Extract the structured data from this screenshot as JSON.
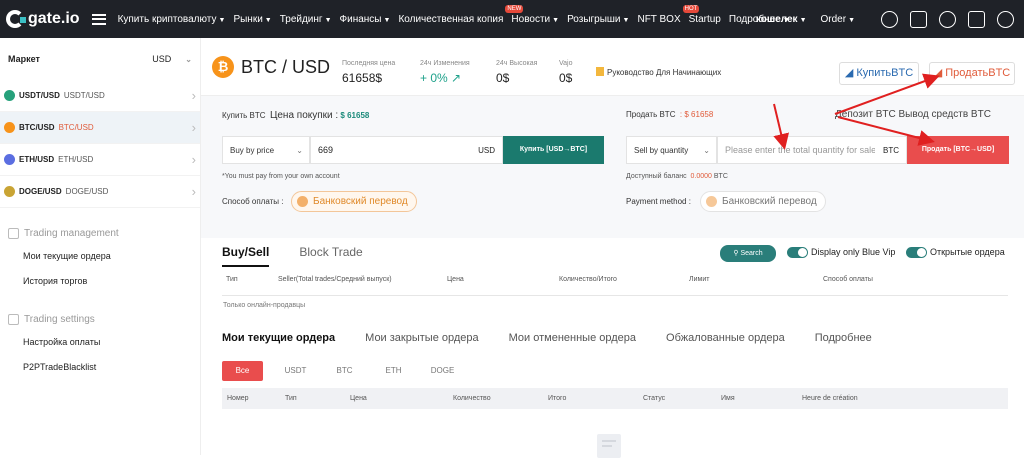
{
  "nav": {
    "logo": "gate.io",
    "links": [
      {
        "label": "Купить криптовалюту",
        "caret": "▼",
        "badge": ""
      },
      {
        "label": "Рынки",
        "caret": "▼",
        "badge": ""
      },
      {
        "label": "Трейдинг",
        "caret": "▼",
        "badge": ""
      },
      {
        "label": "Финансы",
        "caret": "▼",
        "badge": ""
      },
      {
        "label": "Количественная копия",
        "caret": "",
        "badge": ""
      },
      {
        "label": "Новости",
        "caret": "▼",
        "badge": "NEW"
      },
      {
        "label": "Розыгрыши",
        "caret": "▼",
        "badge": ""
      },
      {
        "label": "NFT BOX",
        "caret": "",
        "badge": ""
      },
      {
        "label": "Startup",
        "caret": "",
        "badge": "HOT"
      },
      {
        "label": "Подробнее",
        "caret": "▼",
        "badge": ""
      }
    ],
    "wallet": "кошелек",
    "order": "Order"
  },
  "sidebar": {
    "market_label": "Маркет",
    "currency": "USD",
    "markets": [
      {
        "pair": "USDT/USD",
        "pair2": "USDT/USD",
        "color": "#26a17b"
      },
      {
        "pair": "BTC/USD",
        "pair2": "BTC/USD",
        "color": "#f7931a"
      },
      {
        "pair": "ETH/USD",
        "pair2": "ETH/USD",
        "color": "#5b6ee1"
      },
      {
        "pair": "DOGE/USD",
        "pair2": "DOGE/USD",
        "color": "#c9a434"
      }
    ],
    "trading_management": "Trading management",
    "tm_items": [
      "Мои текущие ордера",
      "История торгов"
    ],
    "trading_settings": "Trading settings",
    "ts_items": [
      "Настройка оплаты",
      "P2PTradeBlacklist"
    ]
  },
  "ticker": {
    "symbol": "₿",
    "pair": "BTC / USD",
    "last_price_label": "Последняя цена",
    "last_price": "61658$",
    "change_label": "24ч Изменения",
    "change": "+ 0% ↗",
    "high_label": "24ч Высокая",
    "high": "0$",
    "vol_label": "Vajo",
    "vol": "0$",
    "guide": "Руководство Для Начинающих",
    "buy_btn": "КупитьBTC",
    "sell_btn": "ПродатьBTC"
  },
  "trade": {
    "buy_label": "Купить BTC",
    "buy_price_label": "Цена покупки :",
    "buy_price": "$ 61658",
    "sell_label": "Продать BTC",
    "sell_price": ": $ 61658",
    "links": "Депозит BTC  Вывод средств BTC",
    "buy_mode": "Buy by price",
    "buy_amount": "669",
    "buy_suffix": "USD",
    "buy_button": "Купить [USD→BTC]",
    "sell_mode": "Sell by quantity",
    "sell_placeholder": "Please enter the total quantity for sale",
    "sell_suffix": "BTC",
    "sell_button": "Продать [BTC→USD]",
    "note": "*You must pay from your own account",
    "balance_label": "Доступный баланс",
    "balance": "0.0000",
    "balance_unit": "BTC",
    "pay_label": "Способ оплаты :",
    "pay_method": "Банковский перевод",
    "pay_label2": "Payment method :",
    "pay_method2": "Банковский перевод"
  },
  "book": {
    "tabs": [
      "Buy/Sell",
      "Block Trade"
    ],
    "search": "Search",
    "toggle1": "Display only Blue Vip",
    "toggle2": "Открытые ордера",
    "columns": [
      "Тип",
      "Seller(Total trades/Средний выпуск)",
      "Цена",
      "Количество/Итого",
      "Лимит",
      "Способ оплаты"
    ],
    "online_only": "Только онлайн-продавцы"
  },
  "orders": {
    "tabs": [
      "Мои текущие ордера",
      "Мои закрытые ордера",
      "Мои отмененные ордера",
      "Обжалованные ордера",
      "Подробнее"
    ],
    "filters": [
      "Все",
      "USDT",
      "BTC",
      "ETH",
      "DOGE"
    ],
    "columns": [
      "Номер",
      "Тип",
      "Цена",
      "Количество",
      "Итого",
      "Статус",
      "Имя",
      "Heure de création"
    ]
  },
  "colors": {
    "accent_teal": "#1b7a6e",
    "accent_red": "#e94d4d",
    "nav_bg": "#1f2228"
  }
}
